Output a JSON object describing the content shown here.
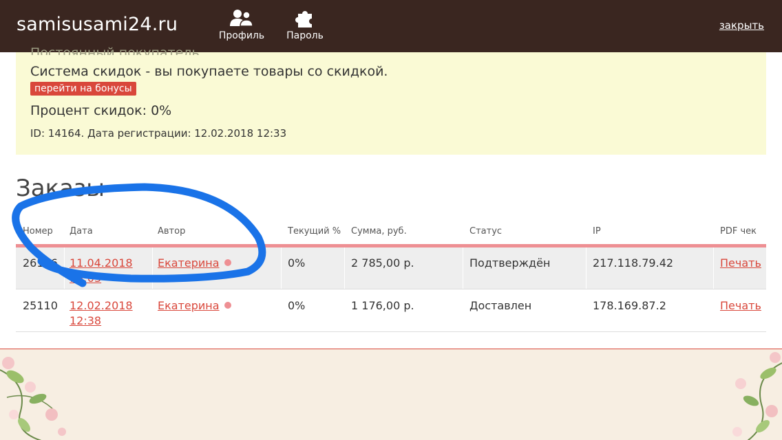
{
  "header": {
    "brand": "samisusami24.ru",
    "nav": [
      {
        "label": "Профиль",
        "icon": "users-icon"
      },
      {
        "label": "Пароль",
        "icon": "puzzle-icon"
      }
    ],
    "close_label": "закрыть"
  },
  "info": {
    "cut_text": "Постоянный покупатель",
    "discount_system": "Система скидок - вы покупаете товары со скидкой.",
    "bonus_button": "перейти на бонусы",
    "discount_percent": "Процент скидок: 0%",
    "registration": "ID: 14164. Дата регистрации: 12.02.2018 12:33"
  },
  "orders": {
    "heading": "Заказы",
    "columns": [
      "Номер",
      "Дата",
      "Автор",
      "Текущий %",
      "Сумма, руб.",
      "Статус",
      "IP",
      "PDF чек"
    ],
    "rows": [
      {
        "number": "26176",
        "date": "11.04.2018",
        "time": "15:03",
        "author": "Екатерина",
        "percent": "0%",
        "sum": "2 785,00 р.",
        "status": "Подтверждён",
        "ip": "217.118.79.42",
        "pdf": "Печать"
      },
      {
        "number": "25110",
        "date": "12.02.2018",
        "time": "12:38",
        "author": "Екатерина",
        "percent": "0%",
        "sum": "1 176,00 р.",
        "status": "Доставлен",
        "ip": "178.169.87.2",
        "pdf": "Печать"
      }
    ]
  },
  "colors": {
    "header_bg": "#3a2620",
    "accent_red": "#d9473b",
    "info_bg": "#fafad5",
    "pink_line": "#ee8f93",
    "annotation_blue": "#1a73e8"
  }
}
